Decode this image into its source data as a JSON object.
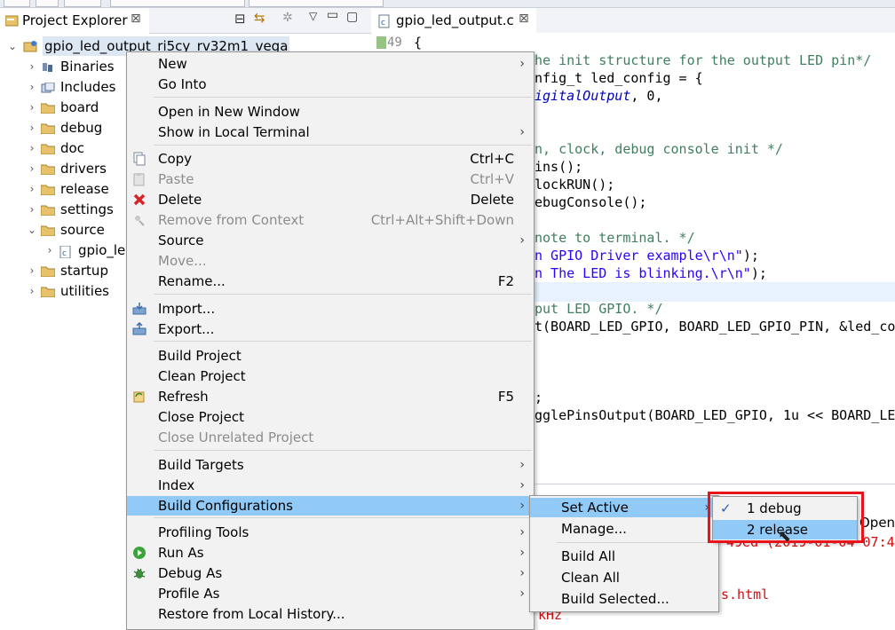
{
  "explorer": {
    "tab_label": "Project Explorer",
    "project": "gpio_led_output_ri5cy_rv32m1_vega",
    "items": [
      {
        "label": "Binaries",
        "icon": "binaries-icon"
      },
      {
        "label": "Includes",
        "icon": "includes-icon"
      },
      {
        "label": "board",
        "icon": "folder-icon"
      },
      {
        "label": "debug",
        "icon": "folder-icon"
      },
      {
        "label": "doc",
        "icon": "folder-icon"
      },
      {
        "label": "drivers",
        "icon": "folder-icon"
      },
      {
        "label": "release",
        "icon": "folder-icon"
      },
      {
        "label": "settings",
        "icon": "folder-icon"
      },
      {
        "label": "source",
        "icon": "folder-icon"
      },
      {
        "label": "gpio_le",
        "icon": "c-file-icon"
      },
      {
        "label": "startup",
        "icon": "folder-icon"
      },
      {
        "label": "utilities",
        "icon": "folder-icon"
      }
    ]
  },
  "editor": {
    "tab_label": "gpio_led_output.c",
    "line_number": "49",
    "brace": "{",
    "lines": [
      {
        "parts": [
          {
            "t": "he init structure for the output LED pin*/",
            "c": "cm"
          }
        ]
      },
      {
        "parts": [
          {
            "t": "nfig_t led_config = {",
            "c": ""
          }
        ]
      },
      {
        "parts": [
          {
            "t": "igitalOutput",
            "c": "it"
          },
          {
            "t": ", 0,",
            "c": ""
          }
        ]
      },
      {
        "parts": [
          {
            "t": "n, clock, debug console init */",
            "c": "cm"
          }
        ]
      },
      {
        "parts": [
          {
            "t": "ins();",
            "c": ""
          }
        ]
      },
      {
        "parts": [
          {
            "t": "lockRUN();",
            "c": ""
          }
        ]
      },
      {
        "parts": [
          {
            "t": "ebugConsole();",
            "c": ""
          }
        ]
      },
      {
        "parts": [
          {
            "t": "note to terminal. */",
            "c": "cm"
          }
        ]
      },
      {
        "parts": [
          {
            "t": "n GPIO Driver example\\r\\n\"",
            "c": "str"
          },
          {
            "t": ");",
            "c": ""
          }
        ]
      },
      {
        "parts": [
          {
            "t": "n The LED is blinking.\\r\\n\"",
            "c": "str"
          },
          {
            "t": ");",
            "c": ""
          }
        ]
      },
      {
        "parts": [
          {
            "t": "put LED GPIO. */",
            "c": "cm"
          }
        ]
      },
      {
        "parts": [
          {
            "t": "t(BOARD_LED_GPIO, BOARD_LED_GPIO_PIN, &led_con",
            "c": ""
          }
        ]
      },
      {
        "parts": [
          {
            "t": ";",
            "c": ""
          }
        ]
      },
      {
        "parts": [
          {
            "t": "gglePinsOutput(BOARD_LED_GPIO, 1u << BOARD_LEI",
            "c": ""
          }
        ]
      }
    ]
  },
  "console": {
    "open_label": "Open",
    "date_text": "49ed (2019-01-04 07:4",
    "file_text": "s.html",
    "freq_text": "kHz"
  },
  "context_menu": {
    "items": [
      {
        "label": "New",
        "submenu": true
      },
      {
        "label": "Go Into"
      },
      {
        "sep": true
      },
      {
        "label": "Open in New Window"
      },
      {
        "label": "Show in Local Terminal",
        "submenu": true
      },
      {
        "sep": true
      },
      {
        "label": "Copy",
        "shortcut": "Ctrl+C",
        "icon": "copy-icon"
      },
      {
        "label": "Paste",
        "shortcut": "Ctrl+V",
        "icon": "paste-icon",
        "disabled": true
      },
      {
        "label": "Delete",
        "shortcut": "Delete",
        "icon": "delete-icon"
      },
      {
        "label": "Remove from Context",
        "shortcut": "Ctrl+Alt+Shift+Down",
        "icon": "remove-context-icon",
        "disabled": true
      },
      {
        "label": "Source",
        "submenu": true
      },
      {
        "label": "Move...",
        "disabled": true
      },
      {
        "label": "Rename...",
        "shortcut": "F2"
      },
      {
        "sep": true
      },
      {
        "label": "Import...",
        "icon": "import-icon"
      },
      {
        "label": "Export...",
        "icon": "export-icon"
      },
      {
        "sep": true
      },
      {
        "label": "Build Project"
      },
      {
        "label": "Clean Project"
      },
      {
        "label": "Refresh",
        "shortcut": "F5",
        "icon": "refresh-icon"
      },
      {
        "label": "Close Project"
      },
      {
        "label": "Close Unrelated Project",
        "disabled": true
      },
      {
        "sep": true
      },
      {
        "label": "Build Targets",
        "submenu": true
      },
      {
        "label": "Index",
        "submenu": true
      },
      {
        "label": "Build Configurations",
        "submenu": true,
        "selected": true
      },
      {
        "sep": true
      },
      {
        "label": "Profiling Tools",
        "submenu": true
      },
      {
        "label": "Run As",
        "submenu": true,
        "icon": "run-icon"
      },
      {
        "label": "Debug As",
        "submenu": true,
        "icon": "debug-bug-icon"
      },
      {
        "label": "Profile As",
        "submenu": true
      },
      {
        "label": "Restore from Local History..."
      }
    ]
  },
  "build_config_menu": {
    "items": [
      {
        "label": "Set Active",
        "submenu": true,
        "selected": true
      },
      {
        "label": "Manage..."
      },
      {
        "sep": true
      },
      {
        "label": "Build All"
      },
      {
        "label": "Clean All"
      },
      {
        "label": "Build Selected..."
      }
    ]
  },
  "set_active_menu": {
    "items": [
      {
        "label": "1 debug",
        "checked": true
      },
      {
        "label": "2 release",
        "selected": true
      }
    ]
  },
  "colors": {
    "selection": "#91c9f7",
    "highlight_box": "#e8141b",
    "comment": "#3f7f5f",
    "string": "#2a00ff"
  }
}
